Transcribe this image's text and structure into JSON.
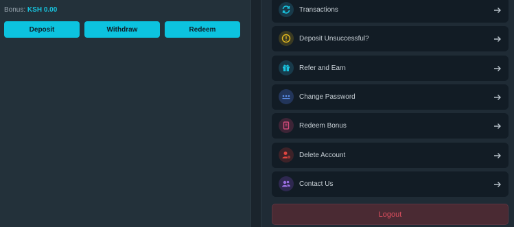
{
  "wallet": {
    "bonus_label": "Bonus:",
    "bonus_amount": "KSH 0.00",
    "buttons": {
      "deposit": "Deposit",
      "withdraw": "Withdraw",
      "redeem": "Redeem"
    }
  },
  "menu": [
    {
      "label": "Transactions",
      "icon": "refresh-icon",
      "icon_bg": "#183a4a",
      "icon_color": "#19c3de"
    },
    {
      "label": "Deposit Unsuccessful?",
      "icon": "warning-icon",
      "icon_bg": "#3a3a22",
      "icon_color": "#e0b720"
    },
    {
      "label": "Refer and Earn",
      "icon": "gift-icon",
      "icon_bg": "#183a4a",
      "icon_color": "#19c3de"
    },
    {
      "label": "Change Password",
      "icon": "password-dots-icon",
      "icon_bg": "#22355a",
      "icon_color": "#5b8de8"
    },
    {
      "label": "Redeem Bonus",
      "icon": "ticket-icon",
      "icon_bg": "#3d2436",
      "icon_color": "#d24a7a"
    },
    {
      "label": "Delete Account",
      "icon": "user-remove-icon",
      "icon_bg": "#3d2228",
      "icon_color": "#e0453f"
    },
    {
      "label": "Contact Us",
      "icon": "contact-users-icon",
      "icon_bg": "#2e2850",
      "icon_color": "#9a6ee0"
    }
  ],
  "logout_label": "Logout",
  "colors": {
    "accent": "#0cc3df",
    "logout_text": "#e04f5f",
    "logout_bg": "#4a2a33"
  }
}
